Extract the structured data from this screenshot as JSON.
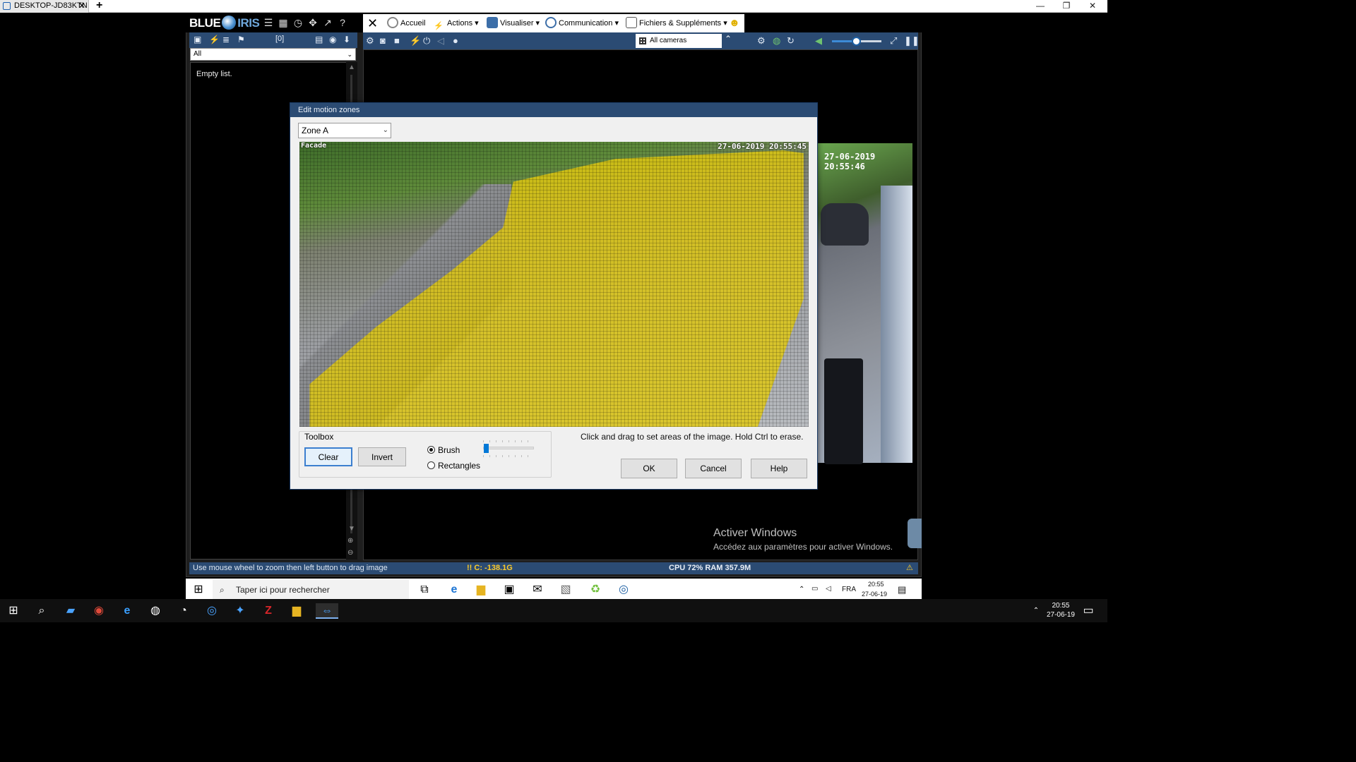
{
  "browser": {
    "tab_title": "DESKTOP-JD83KTN",
    "tab_close": "✕",
    "new_tab": "+",
    "window_controls": [
      "—",
      "❐",
      "✕"
    ]
  },
  "app": {
    "logo_blue": "BLUE",
    "logo_iris": "IRIS",
    "left_counter": "[0]",
    "left_filter_value": "All",
    "list_empty": "Empty list.",
    "menu": {
      "home": "Accueil",
      "actions": "Actions",
      "view": "Visualiser",
      "communication": "Communication",
      "files": "Fichiers & Suppléments"
    },
    "camera_group": "All cameras",
    "second_camera_timestamp": "27-06-2019 20:55:46"
  },
  "dialog": {
    "title": "Edit motion zones",
    "zone_selected": "Zone A",
    "camera_label": "Facade",
    "camera_timestamp": "27-06-2019 20:55:45",
    "zone_color": "#e0c80f",
    "toolbox_title": "Toolbox",
    "clear_button": "Clear",
    "invert_button": "Invert",
    "brush_label": "Brush",
    "rect_label": "Rectangles",
    "brush_selected": true,
    "brush_size_fraction": 0.0,
    "hint": "Click and drag to set areas of the image.  Hold Ctrl to erase.",
    "ok_button": "OK",
    "cancel_button": "Cancel",
    "help_button": "Help"
  },
  "watermark": {
    "line1": "Activer Windows",
    "line2": "Accédez aux paramètres pour activer Windows."
  },
  "status": {
    "hint": "Use mouse wheel to zoom then left button to drag image",
    "disk": "!! C: -138.1G",
    "cpu": "CPU 72% RAM 357.9M"
  },
  "inner_taskbar": {
    "search_placeholder": "Taper ici pour rechercher",
    "lang": "FRA",
    "time": "20:55",
    "date": "27-06-19"
  },
  "taskbar": {
    "time": "20:55",
    "date": "27-06-19"
  },
  "colors": {
    "app_blue": "#2b4b73",
    "warning": "#ffcc2a"
  }
}
